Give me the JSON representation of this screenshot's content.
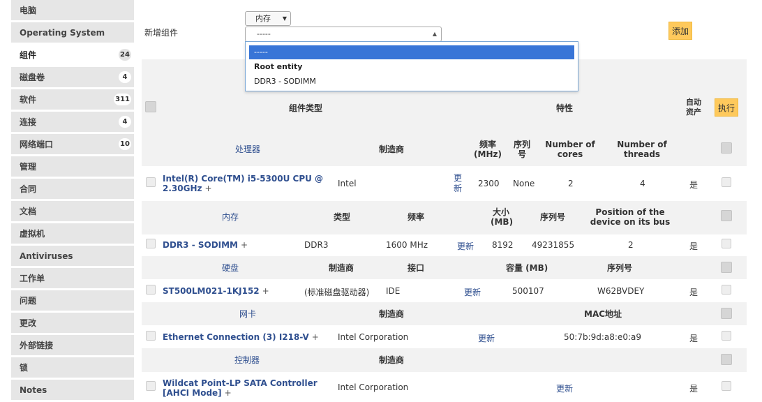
{
  "sidebar": {
    "items": [
      {
        "label": "电脑",
        "badge": ""
      },
      {
        "label": "Operating System",
        "badge": ""
      },
      {
        "label": "组件",
        "badge": "24"
      },
      {
        "label": "磁盘卷",
        "badge": "4"
      },
      {
        "label": "软件",
        "badge": "311"
      },
      {
        "label": "连接",
        "badge": "4"
      },
      {
        "label": "网络端口",
        "badge": "10"
      },
      {
        "label": "管理",
        "badge": ""
      },
      {
        "label": "合同",
        "badge": ""
      },
      {
        "label": "文档",
        "badge": ""
      },
      {
        "label": "虚拟机",
        "badge": ""
      },
      {
        "label": "Antiviruses",
        "badge": ""
      },
      {
        "label": "工作单",
        "badge": ""
      },
      {
        "label": "问题",
        "badge": ""
      },
      {
        "label": "更改",
        "badge": ""
      },
      {
        "label": "外部链接",
        "badge": ""
      },
      {
        "label": "锁",
        "badge": ""
      },
      {
        "label": "Notes",
        "badge": ""
      }
    ],
    "active_index": 2
  },
  "form": {
    "new_label": "新增组件",
    "type_value": "内存",
    "combo_value": "-----",
    "dropdown_options": [
      "-----",
      "Root entity",
      "DDR3 - SODIMM"
    ],
    "add_label": "添加"
  },
  "table": {
    "header": {
      "type_col": "组件类型",
      "props_col": "特性",
      "auto_col": "自动\n资产",
      "exec_label": "执行"
    },
    "processor": {
      "headers": {
        "type": "处理器",
        "maker": "制造商",
        "freq": "频率\n(MHz)",
        "serial": "序列\n号",
        "cores": "Number of\ncores",
        "threads": "Number of\nthreads"
      },
      "row": {
        "name": "Intel(R) Core(TM) i5-5300U CPU @\n2.30GHz",
        "plus": "+",
        "maker": "Intel",
        "update": "更\n新",
        "freq": "2300",
        "serial": "None",
        "cores": "2",
        "threads": "4",
        "auto": "是"
      }
    },
    "memory": {
      "headers": {
        "type": "内存",
        "kind": "类型",
        "freq": "频率",
        "size": "大小\n(MB)",
        "serial": "序列号",
        "position": "Position of the\ndevice on its bus"
      },
      "row": {
        "name": "DDR3 - SODIMM",
        "plus": "+",
        "kind": "DDR3",
        "freq": "1600 MHz",
        "update": "更新",
        "size": "8192",
        "serial": "49231855",
        "position": "2",
        "auto": "是"
      }
    },
    "disk": {
      "headers": {
        "type": "硬盘",
        "maker": "制造商",
        "iface": "接口",
        "capacity": "容量 (MB)",
        "serial": "序列号"
      },
      "row": {
        "name": "ST500LM021-1KJ152",
        "plus": "+",
        "maker": "(标准磁盘驱动器)",
        "iface": "IDE",
        "update": "更新",
        "capacity": "500107",
        "serial": "W62BVDEY",
        "auto": "是"
      }
    },
    "nic": {
      "headers": {
        "type": "网卡",
        "maker": "制造商",
        "mac": "MAC地址"
      },
      "row": {
        "name": "Ethernet Connection (3) I218-V",
        "plus": "+",
        "maker": "Intel Corporation",
        "update": "更新",
        "mac": "50:7b:9d:a8:e0:a9",
        "auto": "是"
      }
    },
    "controller": {
      "headers": {
        "type": "控制器",
        "maker": "制造商"
      },
      "row": {
        "name": "Wildcat Point-LP SATA Controller\n[AHCI Mode]",
        "plus": "+",
        "maker": "Intel Corporation",
        "update": "更新",
        "auto": "是"
      }
    }
  }
}
